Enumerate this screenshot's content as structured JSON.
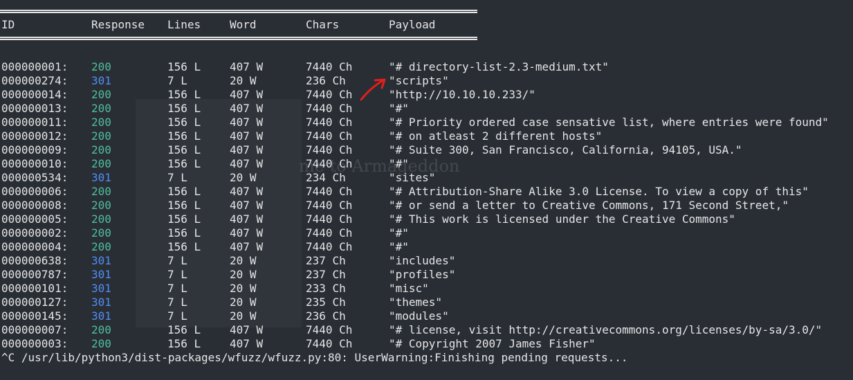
{
  "header": {
    "id": "ID",
    "response": "Response",
    "lines": "Lines",
    "word": "Word",
    "chars": "Chars",
    "payload": "Payload"
  },
  "rows": [
    {
      "id": "000000001:",
      "response": "200",
      "lines": "156 L",
      "word": "407 W",
      "chars": "7440 Ch",
      "payload": "\"# directory-list-2.3-medium.txt\""
    },
    {
      "id": "000000274:",
      "response": "301",
      "lines": "7 L",
      "word": "20 W",
      "chars": "236 Ch",
      "payload": "\"scripts\""
    },
    {
      "id": "000000014:",
      "response": "200",
      "lines": "156 L",
      "word": "407 W",
      "chars": "7440 Ch",
      "payload": "\"http://10.10.10.233/\""
    },
    {
      "id": "000000013:",
      "response": "200",
      "lines": "156 L",
      "word": "407 W",
      "chars": "7440 Ch",
      "payload": "\"#\""
    },
    {
      "id": "000000011:",
      "response": "200",
      "lines": "156 L",
      "word": "407 W",
      "chars": "7440 Ch",
      "payload": "\"# Priority ordered case sensative list, where entries were found\""
    },
    {
      "id": "000000012:",
      "response": "200",
      "lines": "156 L",
      "word": "407 W",
      "chars": "7440 Ch",
      "payload": "\"# on atleast 2 different hosts\""
    },
    {
      "id": "000000009:",
      "response": "200",
      "lines": "156 L",
      "word": "407 W",
      "chars": "7440 Ch",
      "payload": "\"# Suite 300, San Francisco, California, 94105, USA.\""
    },
    {
      "id": "000000010:",
      "response": "200",
      "lines": "156 L",
      "word": "407 W",
      "chars": "7440 Ch",
      "payload": "\"#\""
    },
    {
      "id": "000000534:",
      "response": "301",
      "lines": "7 L",
      "word": "20 W",
      "chars": "234 Ch",
      "payload": "\"sites\""
    },
    {
      "id": "000000006:",
      "response": "200",
      "lines": "156 L",
      "word": "407 W",
      "chars": "7440 Ch",
      "payload": "\"# Attribution-Share Alike 3.0 License. To view a copy of this\""
    },
    {
      "id": "000000008:",
      "response": "200",
      "lines": "156 L",
      "word": "407 W",
      "chars": "7440 Ch",
      "payload": "\"# or send a letter to Creative Commons, 171 Second Street,\""
    },
    {
      "id": "000000005:",
      "response": "200",
      "lines": "156 L",
      "word": "407 W",
      "chars": "7440 Ch",
      "payload": "\"# This work is licensed under the Creative Commons\""
    },
    {
      "id": "000000002:",
      "response": "200",
      "lines": "156 L",
      "word": "407 W",
      "chars": "7440 Ch",
      "payload": "\"#\""
    },
    {
      "id": "000000004:",
      "response": "200",
      "lines": "156 L",
      "word": "407 W",
      "chars": "7440 Ch",
      "payload": "\"#\""
    },
    {
      "id": "000000638:",
      "response": "301",
      "lines": "7 L",
      "word": "20 W",
      "chars": "237 Ch",
      "payload": "\"includes\""
    },
    {
      "id": "000000787:",
      "response": "301",
      "lines": "7 L",
      "word": "20 W",
      "chars": "237 Ch",
      "payload": "\"profiles\""
    },
    {
      "id": "000000101:",
      "response": "301",
      "lines": "7 L",
      "word": "20 W",
      "chars": "233 Ch",
      "payload": "\"misc\""
    },
    {
      "id": "000000127:",
      "response": "301",
      "lines": "7 L",
      "word": "20 W",
      "chars": "235 Ch",
      "payload": "\"themes\""
    },
    {
      "id": "000000145:",
      "response": "301",
      "lines": "7 L",
      "word": "20 W",
      "chars": "236 Ch",
      "payload": "\"modules\""
    },
    {
      "id": "000000007:",
      "response": "200",
      "lines": "156 L",
      "word": "407 W",
      "chars": "7440 Ch",
      "payload": "\"# license, visit http://creativecommons.org/licenses/by-sa/3.0/\""
    },
    {
      "id": "000000003:",
      "response": "200",
      "lines": "156 L",
      "word": "407 W",
      "chars": "7440 Ch",
      "payload": "\"# Copyright 2007 James Fisher\""
    }
  ],
  "footer": "^C /usr/lib/python3/dist-packages/wfuzz/wfuzz.py:80: UserWarning:Finishing pending requests...",
  "colors": {
    "background": "#292e35",
    "text": "#e6e6e6",
    "status_200": "#4fbf9c",
    "status_301": "#4f8ff7",
    "annotation_arrow": "#e0201b"
  },
  "icons": {
    "annotation": "red-hand-drawn-arrow-icon"
  }
}
